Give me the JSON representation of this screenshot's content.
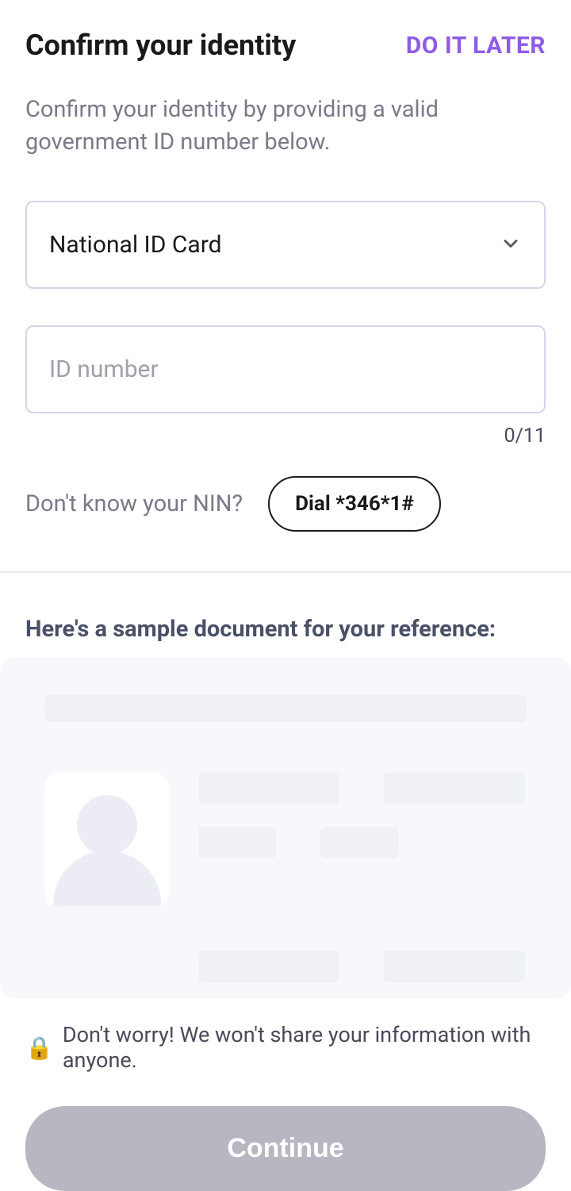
{
  "header": {
    "title": "Confirm your identity",
    "later_link": "DO IT LATER"
  },
  "subtitle": "Confirm your identity by providing a valid government ID number below.",
  "id_type_select": {
    "value": "National ID Card"
  },
  "id_number_input": {
    "placeholder": "ID number",
    "value": ""
  },
  "counter": "0/11",
  "nin": {
    "prompt": "Don't know your NIN?",
    "dial_label": "Dial *346*1#"
  },
  "sample": {
    "title": "Here's a sample document for your reference:"
  },
  "privacy": {
    "lock_icon": "🔒",
    "text": "Don't worry! We won't share your information with anyone."
  },
  "continue_label": "Continue"
}
